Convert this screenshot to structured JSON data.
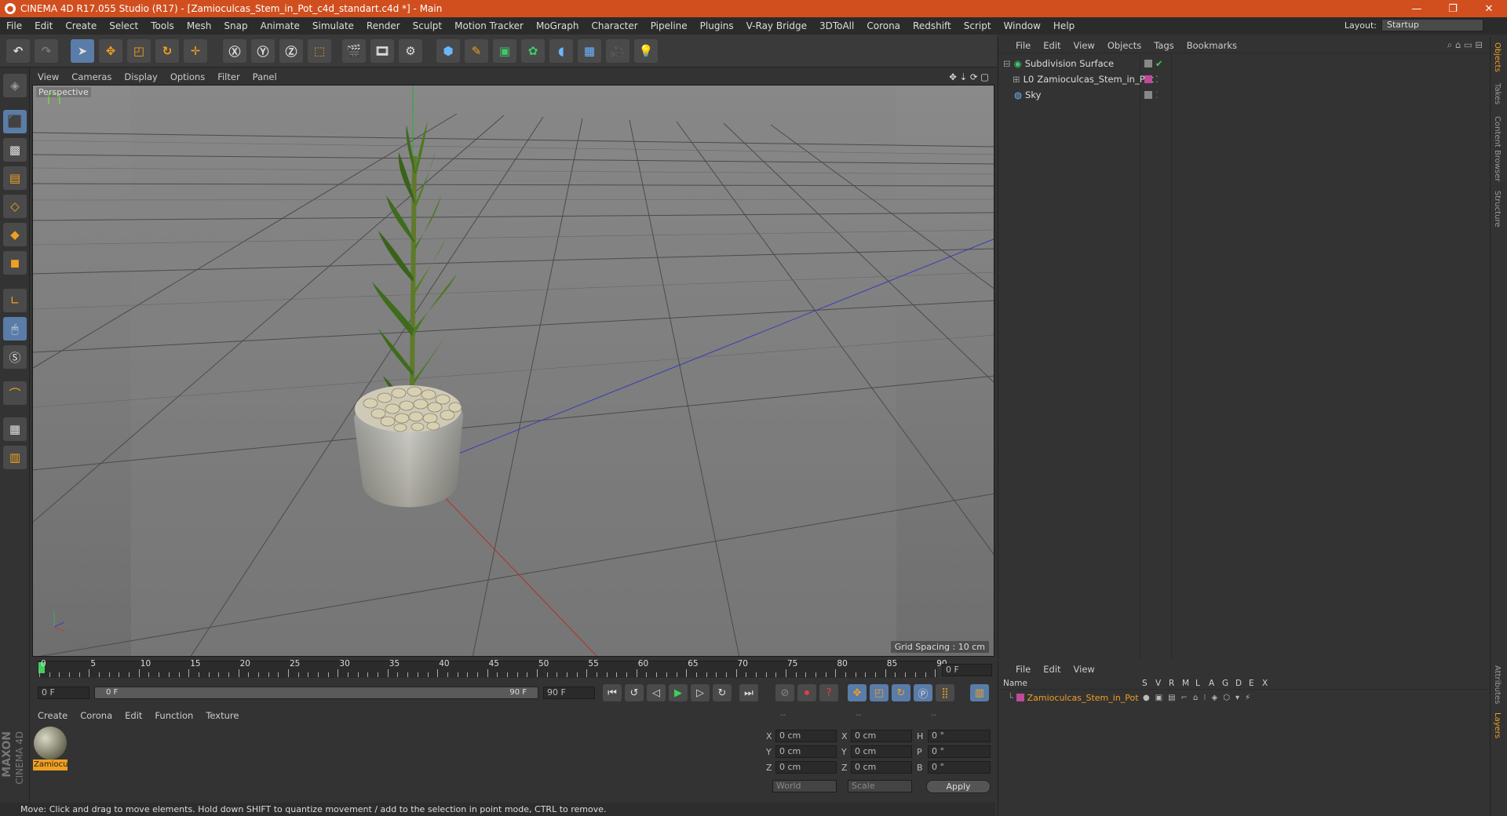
{
  "window": {
    "title": "CINEMA 4D R17.055 Studio (R17) - [Zamioculcas_Stem_in_Pot_c4d_standart.c4d *] - Main"
  },
  "menu": [
    "File",
    "Edit",
    "Create",
    "Select",
    "Tools",
    "Mesh",
    "Snap",
    "Animate",
    "Simulate",
    "Render",
    "Sculpt",
    "Motion Tracker",
    "MoGraph",
    "Character",
    "Pipeline",
    "Plugins",
    "V-Ray Bridge",
    "3DToAll",
    "Corona",
    "Redshift",
    "Script",
    "Window",
    "Help"
  ],
  "layout": {
    "label": "Layout:",
    "value": "Startup"
  },
  "viewport": {
    "menu": [
      "View",
      "Cameras",
      "Display",
      "Options",
      "Filter",
      "Panel"
    ],
    "label": "Perspective",
    "grid_spacing": "Grid Spacing : 10 cm"
  },
  "timeline": {
    "ticks": [
      "0",
      "5",
      "10",
      "15",
      "20",
      "25",
      "30",
      "35",
      "40",
      "45",
      "50",
      "55",
      "60",
      "65",
      "70",
      "75",
      "80",
      "85",
      "90"
    ],
    "current_frame": "0 F",
    "start_field": "0 F",
    "range_start": "0 F",
    "range_end": "90 F",
    "end_field": "90 F"
  },
  "material_manager": {
    "menu": [
      "Create",
      "Corona",
      "Edit",
      "Function",
      "Texture"
    ],
    "material_name": "Zamiocu"
  },
  "coordinates": {
    "header": [
      "--",
      "--",
      "--"
    ],
    "rows": [
      {
        "a": "X",
        "av": "0 cm",
        "b": "X",
        "bv": "0 cm",
        "c": "H",
        "cv": "0 °"
      },
      {
        "a": "Y",
        "av": "0 cm",
        "b": "Y",
        "bv": "0 cm",
        "c": "P",
        "cv": "0 °"
      },
      {
        "a": "Z",
        "av": "0 cm",
        "b": "Z",
        "bv": "0 cm",
        "c": "B",
        "cv": "0 °"
      }
    ],
    "mode1": "World",
    "mode2": "Scale",
    "apply": "Apply"
  },
  "status": "Move: Click and drag to move elements. Hold down SHIFT to quantize movement / add to the selection in point mode, CTRL to remove.",
  "object_manager": {
    "menu": [
      "File",
      "Edit",
      "View",
      "Objects",
      "Tags",
      "Bookmarks"
    ],
    "objects": [
      "Subdivision Surface",
      "Zamioculcas_Stem_in_Pot",
      "Sky"
    ]
  },
  "layer_manager": {
    "menu": [
      "File",
      "Edit",
      "View"
    ],
    "columns": [
      "Name",
      "S",
      "V",
      "R",
      "M",
      "L",
      "A",
      "G",
      "D",
      "E",
      "X"
    ],
    "layer": "Zamioculcas_Stem_in_Pot"
  },
  "right_tabs": [
    "Objects",
    "Takes",
    "Content Browser",
    "Structure",
    "Attributes",
    "Layers"
  ],
  "branding": [
    "MAXON",
    "CINEMA 4D"
  ]
}
